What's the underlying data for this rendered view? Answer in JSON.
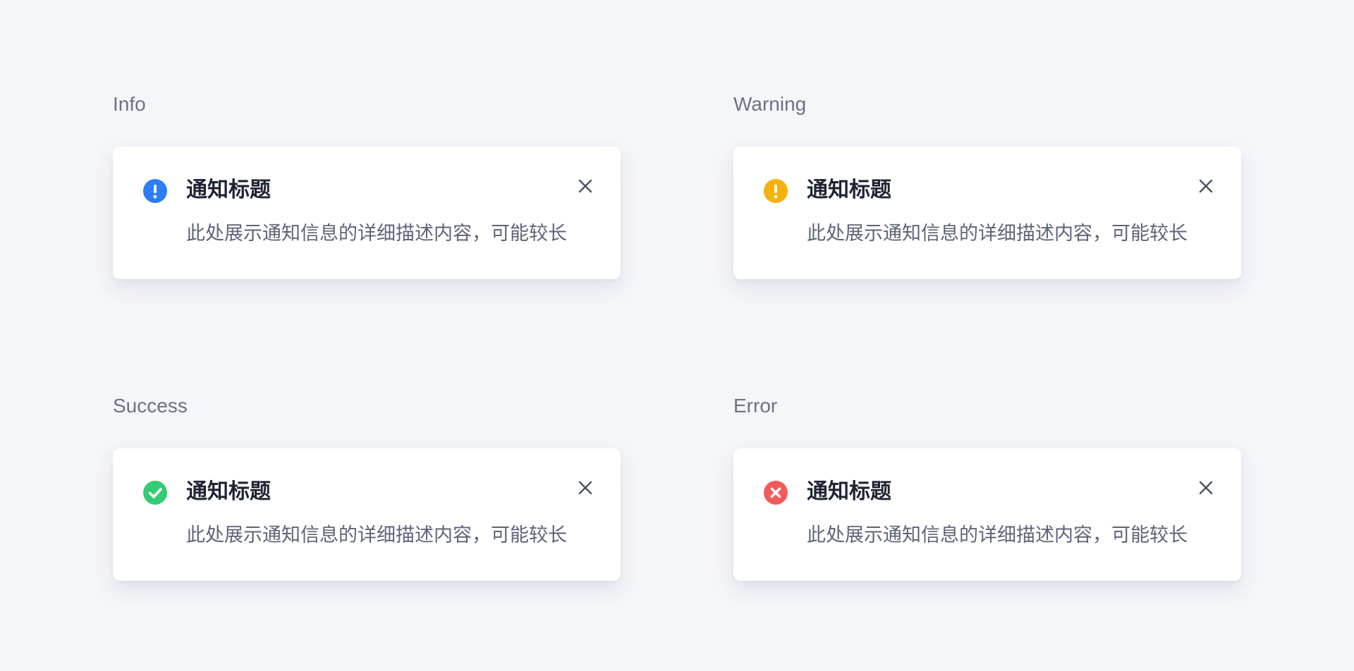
{
  "notifications": [
    {
      "section_label": "Info",
      "title": "通知标题",
      "description": "此处展示通知信息的详细描述内容，可能较长",
      "icon": "info-exclamation-icon",
      "color": "#2f7df6"
    },
    {
      "section_label": "Warning",
      "title": "通知标题",
      "description": "此处展示通知信息的详细描述内容，可能较长",
      "icon": "warning-exclamation-icon",
      "color": "#f5b10c"
    },
    {
      "section_label": "Success",
      "title": "通知标题",
      "description": "此处展示通知信息的详细描述内容，可能较长",
      "icon": "success-check-icon",
      "color": "#33cc73"
    },
    {
      "section_label": "Error",
      "title": "通知标题",
      "description": "此处展示通知信息的详细描述内容，可能较长",
      "icon": "error-x-icon",
      "color": "#f25a5a"
    }
  ],
  "close_icon": "close-icon",
  "close_color": "#4b5263"
}
